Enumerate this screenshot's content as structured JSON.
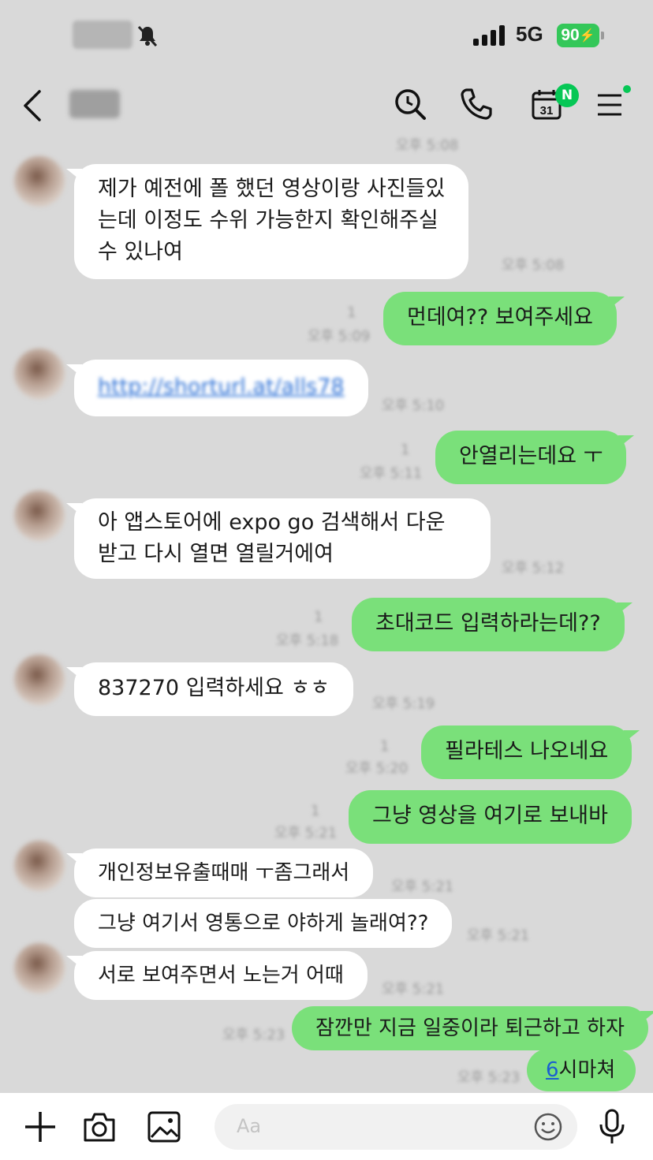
{
  "status": {
    "network": "5G",
    "battery": "90"
  },
  "header": {
    "calendar_day": "31",
    "badge": "N"
  },
  "messages": [
    {
      "dir": "in",
      "lines": [
        "제가 예전에 폴 했던 영상이랑 사진들있",
        "는데 이정도 수위 가능한지 확인해주실",
        "수 있나여"
      ],
      "time": "오후 5:08"
    },
    {
      "dir": "out",
      "text": "먼데여?? 보여주세요",
      "read": "1",
      "time": "오후 5:09"
    },
    {
      "dir": "in",
      "text": "http://shorturl.at/alls78",
      "time": "오후 5:10"
    },
    {
      "dir": "out",
      "text": "안열리는데요 ㅜ",
      "read": "1",
      "time": "오후 5:11"
    },
    {
      "dir": "in",
      "lines": [
        "아 앱스토어에 expo go 검색해서 다운",
        "받고 다시 열면 열릴거에여"
      ],
      "time": "오후 5:12"
    },
    {
      "dir": "out",
      "text": "초대코드 입력하라는데??",
      "read": "1",
      "time": "오후 5:18"
    },
    {
      "dir": "in",
      "text": "837270 입력하세요 ㅎㅎ",
      "time": "오후 5:19"
    },
    {
      "dir": "out",
      "text": "필라테스 나오네요",
      "read": "1",
      "time": "오후 5:20"
    },
    {
      "dir": "out",
      "text": "그냥 영상을 여기로 보내바",
      "read": "1",
      "time": "오후 5:21"
    },
    {
      "dir": "in",
      "text": "개인정보유출때매 ㅜ좀그래서",
      "time": "오후 5:21"
    },
    {
      "dir": "in",
      "text": "그냥 여기서 영통으로 야하게 놀래여??",
      "time": "오후 5:21"
    },
    {
      "dir": "in",
      "text": "서로 보여주면서 노는거 어때",
      "time": "오후 5:21"
    },
    {
      "dir": "out",
      "text": "잠깐만 지금 일중이라 퇴근하고 하자",
      "time": "오후 5:23"
    },
    {
      "dir": "out",
      "text_link": "6",
      "text_rest": "시마쳐",
      "time": "오후 5:23"
    }
  ],
  "input": {
    "placeholder": "Aa"
  },
  "colors": {
    "background": "#d9d9d9",
    "outgoing_bubble": "#7ae07a",
    "incoming_bubble": "#ffffff",
    "accent": "#06c755"
  },
  "icons": [
    "back-icon",
    "search-icon",
    "phone-icon",
    "calendar-icon",
    "menu-icon",
    "plus-icon",
    "camera-icon",
    "image-icon",
    "emoji-icon",
    "mic-icon"
  ]
}
